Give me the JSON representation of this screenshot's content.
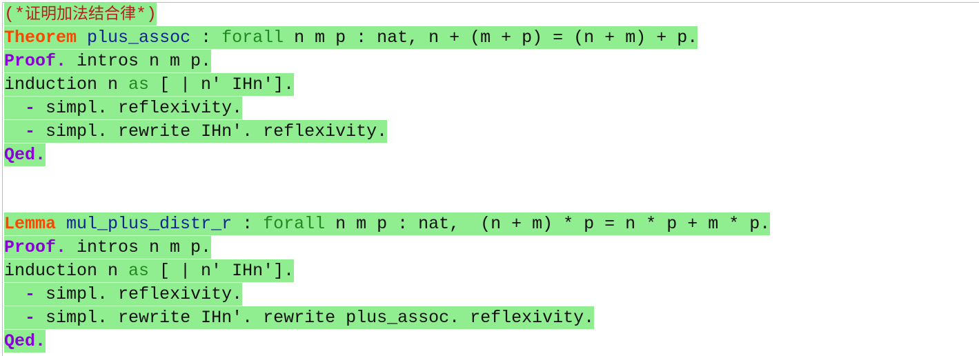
{
  "editor": {
    "highlight_color": "#90ee90",
    "colors": {
      "declaration_keyword": "#ff4500",
      "proof_keyword": "#8b00d6",
      "identifier": "#10238f",
      "green_keyword": "#208a20",
      "comment": "#b22222"
    },
    "comment": {
      "open": "(*",
      "text": "证明加法结合律",
      "close": "*)"
    },
    "block1": {
      "decl_kw": "Theorem",
      "name": "plus_assoc",
      "colon": " : ",
      "forall": "forall",
      "stmt": " n m p : nat, n + (m + p) = (n + m) + p.",
      "proof_kw": "Proof.",
      "proof_rest": " intros n m p.",
      "induction_pre": "induction n ",
      "as_kw": "as",
      "induction_post": " [ | n' IHn'].",
      "bullet": "-",
      "case1": " simpl. reflexivity.",
      "case2": " simpl. rewrite IHn'. reflexivity.",
      "qed": "Qed."
    },
    "block2": {
      "decl_kw": "Lemma",
      "name": "mul_plus_distr_r",
      "colon": " : ",
      "forall": "forall",
      "stmt": " n m p : nat,  (n + m) * p = n * p + m * p.",
      "proof_kw": "Proof.",
      "proof_rest": " intros n m p.",
      "induction_pre": "induction n ",
      "as_kw": "as",
      "induction_post": " [ | n' IHn'].",
      "bullet": "-",
      "case1": " simpl. reflexivity.",
      "case2": " simpl. rewrite IHn'. rewrite plus_assoc. reflexivity.",
      "qed": "Qed."
    }
  }
}
